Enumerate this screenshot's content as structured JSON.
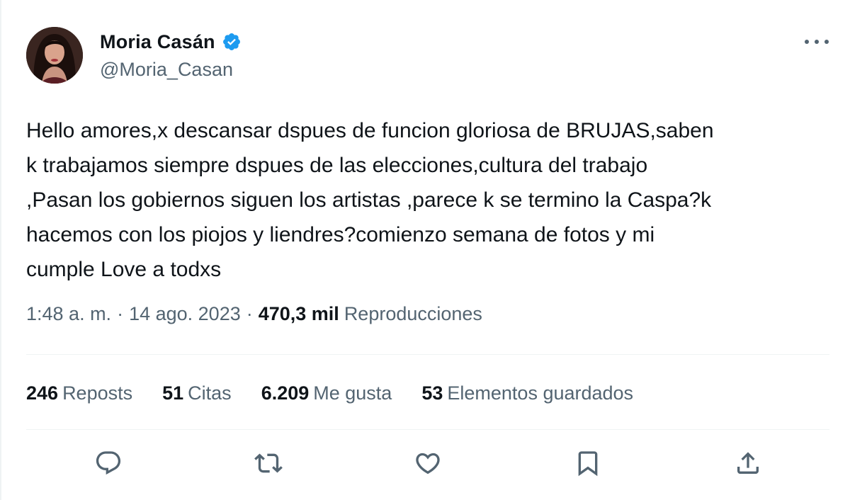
{
  "author": {
    "display_name": "Moria Casán",
    "handle": "@Moria_Casan",
    "verified": true,
    "avatar_icon": "profile-photo"
  },
  "more_icon": "more-horizontal-icon",
  "tweet": {
    "text": "Hello amores,x descansar dspues de funcion gloriosa de BRUJAS,saben\nk trabajamos siempre dspues de las elecciones,cultura del trabajo\n,Pasan los gobiernos siguen los artistas ,parece k se termino la Caspa?k\nhacemos con los piojos y liendres?comienzo semana de fotos y mi\ncumple Love a todxs"
  },
  "meta": {
    "time": "1:48 a. m.",
    "separator": "·",
    "date": "14 ago. 2023",
    "views_count": "470,3 mil",
    "views_label": "Reproducciones"
  },
  "stats": [
    {
      "count": "246",
      "label": "Reposts"
    },
    {
      "count": "51",
      "label": "Citas"
    },
    {
      "count": "6.209",
      "label": "Me gusta"
    },
    {
      "count": "53",
      "label": "Elementos guardados"
    }
  ],
  "actions": [
    {
      "name": "reply-icon"
    },
    {
      "name": "repost-icon"
    },
    {
      "name": "like-icon"
    },
    {
      "name": "bookmark-icon"
    },
    {
      "name": "share-icon"
    }
  ],
  "colors": {
    "text_primary": "#0f1419",
    "text_secondary": "#536471",
    "divider": "#eff3f4",
    "verified_blue": "#1d9bf0"
  }
}
